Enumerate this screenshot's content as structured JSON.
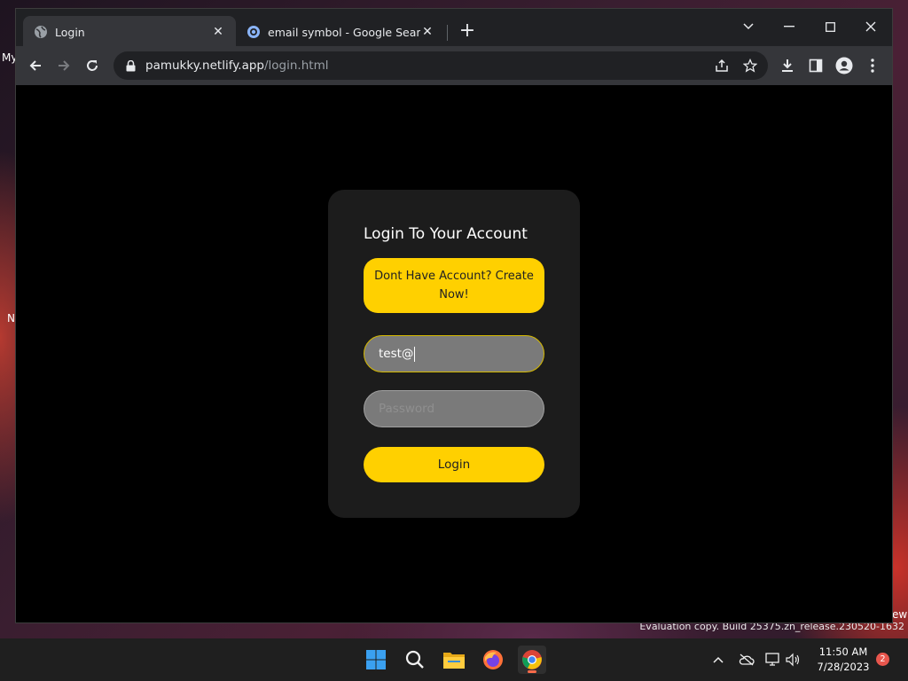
{
  "desktop": {
    "label_1": "My",
    "label_2": "N",
    "label_3": "ew",
    "evaluation": "Evaluation copy. Build 25375.zn_release.230520-1632"
  },
  "browser": {
    "tabs": [
      {
        "title": "Login",
        "favicon": "globe-icon",
        "active": true
      },
      {
        "title": "email symbol - Google Search",
        "favicon": "google-icon",
        "active": false
      }
    ],
    "address": {
      "domain": "pamukky.netlify.app",
      "path": "/login.html"
    }
  },
  "page": {
    "title": "Login To Your Account",
    "create_account": "Dont Have Account? Create Now!",
    "email_value": "test@",
    "password_placeholder": "Password",
    "login_label": "Login"
  },
  "colors": {
    "accent": "#ffd000",
    "card": "#1c1c1c",
    "field": "#7a7a7a",
    "background": "#000000"
  },
  "taskbar": {
    "apps": [
      "windows-start-icon",
      "search-icon",
      "file-explorer-icon",
      "firefox-icon",
      "chrome-icon"
    ],
    "time": "11:50 AM",
    "date": "7/28/2023",
    "notification_count": "2"
  }
}
